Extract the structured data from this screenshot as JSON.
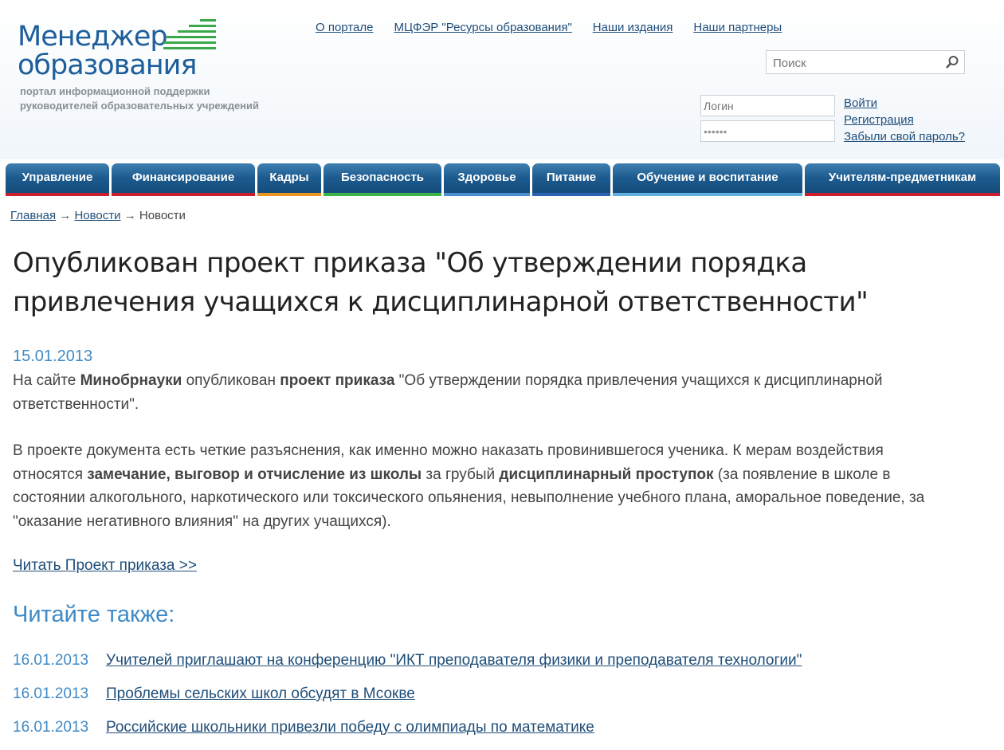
{
  "logo": {
    "line1": "Менеджер",
    "line2": "образования",
    "tagline1": "портал информационной поддержки",
    "tagline2": "руководителей образовательных учреждений"
  },
  "topnav": [
    "О портале",
    "МЦФЭР \"Ресурсы образования\"",
    "Наши издания",
    "Наши партнеры"
  ],
  "search": {
    "placeholder": "Поиск",
    "icon": "search-icon"
  },
  "auth": {
    "login_placeholder": "Логин",
    "password_value": "••••••",
    "login_link": "Войти",
    "register_link": "Регистрация",
    "forgot_link": "Забыли свой пароль?"
  },
  "menu": [
    {
      "label": "Управление",
      "color": "#c8202f"
    },
    {
      "label": "Финансирование",
      "color": "#c8202f"
    },
    {
      "label": "Кадры",
      "color": "#e8961e"
    },
    {
      "label": "Безопасность",
      "color": "#3bb44a"
    },
    {
      "label": "Здоровье",
      "color": "#4a8fcf"
    },
    {
      "label": "Питание",
      "color": "#2b63b3"
    },
    {
      "label": "Обучение и воспитание",
      "color": "#5fb0e0"
    },
    {
      "label": "Учителям-предметникам",
      "color": "#c8202f"
    }
  ],
  "breadcrumb": {
    "home": "Главная",
    "sep": "→",
    "news_link": "Новости",
    "current": "Новости"
  },
  "article": {
    "title": "Опубликован проект приказа \"Об утверждении порядка привлечения учащихся к дисциплинарной ответственности\"",
    "date": "15.01.2013",
    "p1": {
      "t1": "На сайте ",
      "b1": "Минобрнауки",
      "t2": " опубликован ",
      "b2": "проект приказа",
      "t3": " \"Об утверждении порядка привлечения учащихся к дисциплинарной ответственности\"."
    },
    "p2": {
      "t1": "В проекте документа есть четкие разъяснения, как именно можно наказать провинившегося ученика. К мерам воздействия относятся ",
      "b1": "замечание, выговор и отчисление из школы",
      "t2": " за грубый ",
      "b2": "дисциплинарный проступок",
      "t3": " (за появление в школе в состоянии алкогольного, наркотического или токсического опьянения, невыполнение учебного плана, аморальное поведение, за \"оказание негативного влияния\" на других учащихся)."
    },
    "read_link": "Читать Проект приказа >>"
  },
  "also": {
    "title": "Читайте также:",
    "items": [
      {
        "date": "16.01.2013",
        "title": "Учителей приглашают на конференцию \"ИКТ преподавателя физики и преподавателя технологии\""
      },
      {
        "date": "16.01.2013",
        "title": "Проблемы сельских школ обсудят в Мсокве"
      },
      {
        "date": "16.01.2013",
        "title": "Российские школьники привезли победу с олимпиады по математике"
      }
    ]
  }
}
